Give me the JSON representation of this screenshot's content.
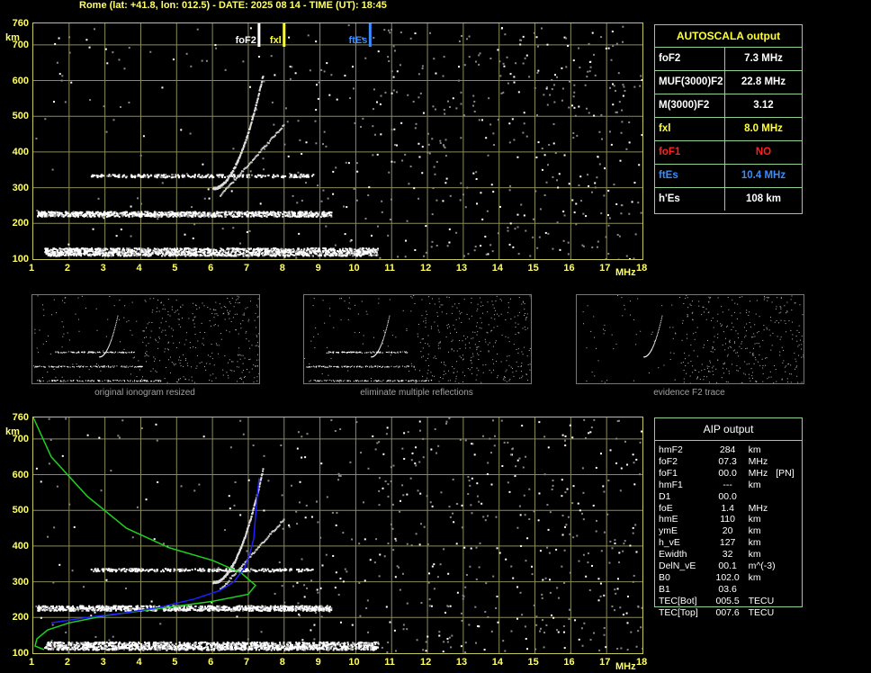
{
  "header": {
    "title": "Rome (lat: +41.8, lon: 012.5) - DATE: 2025 08 14 - TIME (UT): 18:45"
  },
  "axes": {
    "y_unit": "km",
    "x_unit": "MHz",
    "y_ticks": [
      "760",
      "700",
      "600",
      "500",
      "400",
      "300",
      "200",
      "100"
    ],
    "x_ticks": [
      "1",
      "2",
      "3",
      "4",
      "5",
      "6",
      "7",
      "8",
      "9",
      "10",
      "11",
      "12",
      "13",
      "14",
      "15",
      "16",
      "17",
      "18"
    ]
  },
  "chart_data": [
    {
      "type": "scatter",
      "name": "top-ionogram",
      "xlim": [
        1,
        18
      ],
      "ylim": [
        100,
        760
      ],
      "grid": true,
      "markers": [
        {
          "label": "foF2",
          "x": 7.3,
          "color": "#ffffff"
        },
        {
          "label": "fxl",
          "x": 8.0,
          "color": "#ffff33"
        },
        {
          "label": "ftEs",
          "x": 10.4,
          "color": "#3a8dff"
        }
      ]
    },
    {
      "type": "line",
      "name": "aip-ionogram",
      "xlim": [
        1,
        18
      ],
      "ylim": [
        100,
        760
      ],
      "grid": true,
      "series": [
        {
          "color": "#1fd01f",
          "points": [
            [
              1,
              760
            ],
            [
              1.5,
              650
            ],
            [
              2.5,
              540
            ],
            [
              3.6,
              450
            ],
            [
              4.8,
              395
            ],
            [
              6.0,
              360
            ],
            [
              6.8,
              325
            ],
            [
              7.2,
              290
            ],
            [
              7.0,
              265
            ],
            [
              6.0,
              245
            ],
            [
              4.5,
              225
            ],
            [
              3.0,
              205
            ],
            [
              2.0,
              185
            ],
            [
              1.4,
              165
            ],
            [
              1.1,
              140
            ],
            [
              1.05,
              120
            ],
            [
              1.3,
              110
            ]
          ]
        },
        {
          "color": "#2020ff",
          "points": [
            [
              1.5,
              185
            ],
            [
              2.5,
              200
            ],
            [
              3.5,
              212
            ],
            [
              4.5,
              228
            ],
            [
              5.5,
              252
            ],
            [
              6.2,
              275
            ],
            [
              6.6,
              300
            ],
            [
              6.9,
              340
            ],
            [
              7.05,
              380
            ],
            [
              7.15,
              420
            ],
            [
              7.2,
              480
            ],
            [
              7.25,
              540
            ],
            [
              7.3,
              590
            ]
          ]
        }
      ]
    }
  ],
  "thumbs": [
    {
      "caption": "original ionogram resized"
    },
    {
      "caption": "eliminate multiple reflections"
    },
    {
      "caption": "evidence F2 trace"
    }
  ],
  "autoscala": {
    "title": "AUTOSCALA output",
    "rows": [
      {
        "key": "foF2",
        "value": "7.3 MHz",
        "color": "#ffffff"
      },
      {
        "key": "MUF(3000)F2",
        "value": "22.8 MHz",
        "color": "#ffffff"
      },
      {
        "key": "M(3000)F2",
        "value": "3.12",
        "color": "#ffffff"
      },
      {
        "key": "fxl",
        "value": "8.0 MHz",
        "color": "#ffff33"
      },
      {
        "key": "foF1",
        "value": "NO",
        "color": "#ff2020"
      },
      {
        "key": "ftEs",
        "value": "10.4 MHz",
        "color": "#3a8dff"
      },
      {
        "key": "h'Es",
        "value": "108     km",
        "color": "#ffffff"
      }
    ]
  },
  "aip": {
    "title": "AIP output",
    "rows": [
      [
        "hmF2",
        "284",
        "km",
        ""
      ],
      [
        "foF2",
        "07.3",
        "MHz",
        ""
      ],
      [
        "foF1",
        "00.0",
        "MHz",
        "[PN]"
      ],
      [
        "hmF1",
        "---",
        "km",
        ""
      ],
      [
        "D1",
        "00.0",
        "",
        ""
      ],
      [
        "foE",
        "1.4",
        "MHz",
        ""
      ],
      [
        "hmE",
        "110",
        "km",
        ""
      ],
      [
        "ymE",
        "20",
        "km",
        ""
      ],
      [
        "h_vE",
        "127",
        "km",
        ""
      ],
      [
        "Ewidth",
        "32",
        "km",
        ""
      ],
      [
        "DelN_vE",
        "00.1",
        "m^(-3)",
        ""
      ],
      [
        "B0",
        "102.0",
        "km",
        ""
      ],
      [
        "B1",
        "03.6",
        "",
        ""
      ],
      [
        "TEC[Bot]",
        "005.5",
        "TECU",
        ""
      ],
      [
        "TEC[Top]",
        "007.6",
        "TECU",
        ""
      ]
    ]
  }
}
